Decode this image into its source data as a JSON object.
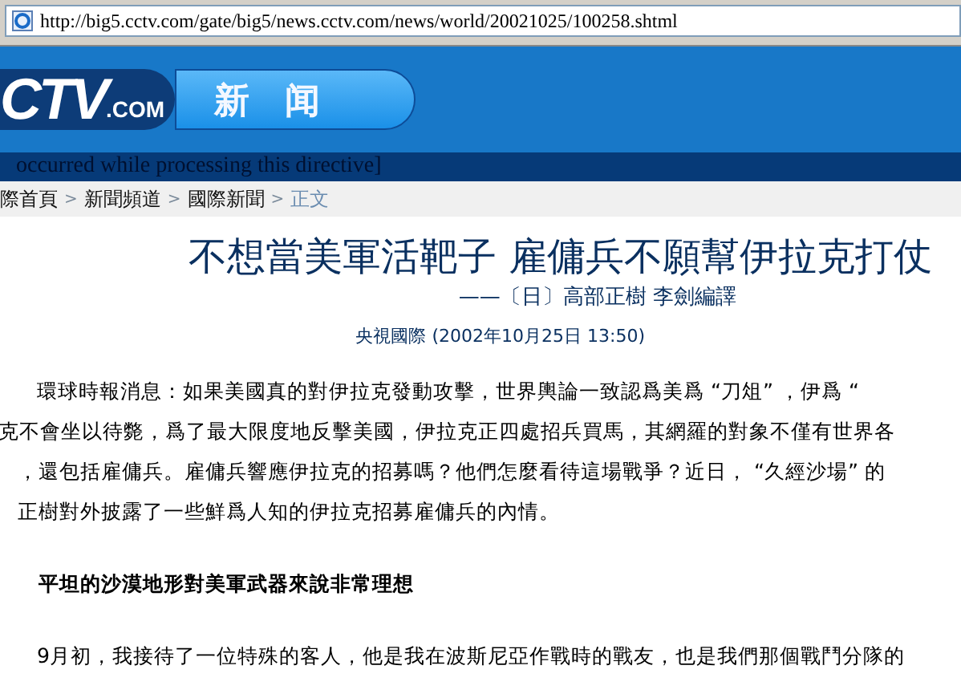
{
  "address_bar": {
    "url": "http://big5.cctv.com/gate/big5/news.cctv.com/news/world/20021025/100258.shtml"
  },
  "header": {
    "logo": "CTV",
    "logo_suffix": ".COM",
    "section": "新　闻"
  },
  "error_strip": "occurred while processing this directive]",
  "breadcrumb": {
    "separator": ">",
    "items": [
      {
        "label": "際首頁",
        "current": false
      },
      {
        "label": "新聞頻道",
        "current": false
      },
      {
        "label": "國際新聞",
        "current": false
      },
      {
        "label": "正文",
        "current": true
      }
    ]
  },
  "article": {
    "title": "不想當美軍活靶子 雇傭兵不願幫伊拉克打仗",
    "byline": "——〔日〕高部正樹 李劍編譯",
    "source": "央視國際 (2002年10月25日 13:50)",
    "blocks": [
      {
        "kind": "line",
        "indent": true,
        "text": "環球時報消息：如果美國真的對伊拉克發動攻擊，世界輿論一致認爲美爲 “刀俎” ，伊爲 “"
      },
      {
        "kind": "line",
        "indent": false,
        "text": "克不會坐以待斃，爲了最大限度地反擊美國，伊拉克正四處招兵買馬，其網羅的對象不僅有世界各"
      },
      {
        "kind": "line",
        "indent": false,
        "text": "，還包括雇傭兵。雇傭兵響應伊拉克的招募嗎？他們怎麼看待這場戰爭？近日， “久經沙場” 的"
      },
      {
        "kind": "line",
        "indent": false,
        "text": "正樹對外披露了一些鮮爲人知的伊拉克招募雇傭兵的內情。"
      },
      {
        "kind": "heading",
        "indent": true,
        "text": "平坦的沙漠地形對美軍武器來說非常理想"
      },
      {
        "kind": "line",
        "indent": true,
        "text": "9月初，我接待了一位特殊的客人，他是我在波斯尼亞作戰時的戰友，也是我們那個戰鬥分隊的"
      }
    ]
  }
}
